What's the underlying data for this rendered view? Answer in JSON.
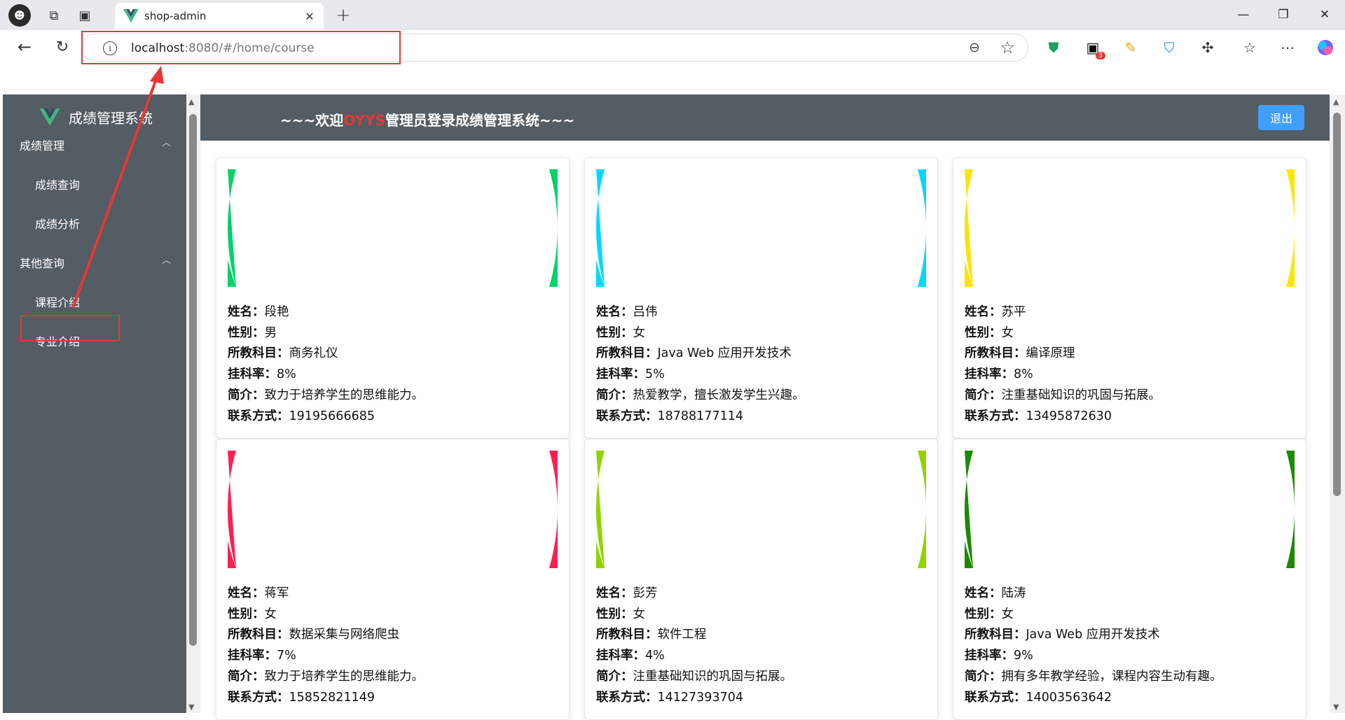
{
  "browser": {
    "tab_title": "shop-admin",
    "url_host": "localhost",
    "url_rest": ":8080/#/home/course",
    "extension_badge": "3"
  },
  "sidebar": {
    "title": "成绩管理系统",
    "groups": [
      {
        "label": "成绩管理",
        "items": [
          "成绩查询",
          "成绩分析"
        ]
      },
      {
        "label": "其他查询",
        "items": [
          "课程介绍",
          "专业介绍"
        ]
      }
    ],
    "active_item": "课程介绍"
  },
  "header": {
    "welcome_prefix": "~~~欢迎",
    "username": "OYYS",
    "welcome_suffix": "管理员登录成绩管理系统~~~",
    "logout_label": "退出"
  },
  "field_labels": {
    "name": "姓名：",
    "gender": "性别：",
    "subject": "所教科目：",
    "fail_rate": "挂科率：",
    "intro": "简介：",
    "contact": "联系方式："
  },
  "teachers": [
    {
      "name": "段艳",
      "gender": "男",
      "subject": "商务礼仪",
      "fail_rate": "8%",
      "intro": "致力于培养学生的思维能力。",
      "contact": "19195666685",
      "avatar_icon": "smiling-face-blonde-icon",
      "bg": "#00d26a"
    },
    {
      "name": "吕伟",
      "gender": "女",
      "subject": "Java Web 应用开发技术",
      "fail_rate": "5%",
      "intro": "热爱教学，擅长激发学生兴趣。",
      "contact": "18788177114",
      "avatar_icon": "pink-sunglasses-face-icon",
      "bg": "#00d8ff"
    },
    {
      "name": "苏平",
      "gender": "女",
      "subject": "编译原理",
      "fail_rate": "8%",
      "intro": "注重基础知识的巩固与拓展。",
      "contact": "13495872630",
      "avatar_icon": "laughing-face-icon",
      "bg": "#ffe600"
    },
    {
      "name": "蒋军",
      "gender": "女",
      "subject": "数据采集与网络爬虫",
      "fail_rate": "7%",
      "intro": "致力于培养学生的思维能力。",
      "contact": "15852821149",
      "avatar_icon": "devil-face-icon",
      "bg": "#ff1f4f"
    },
    {
      "name": "彭芳",
      "gender": "女",
      "subject": "软件工程",
      "fail_rate": "4%",
      "intro": "注重基础知识的巩固与拓展。",
      "contact": "14127393704",
      "avatar_icon": "teal-sunglasses-face-icon",
      "bg": "#8fd400"
    },
    {
      "name": "陆涛",
      "gender": "女",
      "subject": "Java Web 应用开发技术",
      "fail_rate": "9%",
      "intro": "拥有多年教学经验，课程内容生动有趣。",
      "contact": "14003563642",
      "avatar_icon": "pixel-sunglasses-face-icon",
      "bg": "#1a8a00"
    }
  ]
}
